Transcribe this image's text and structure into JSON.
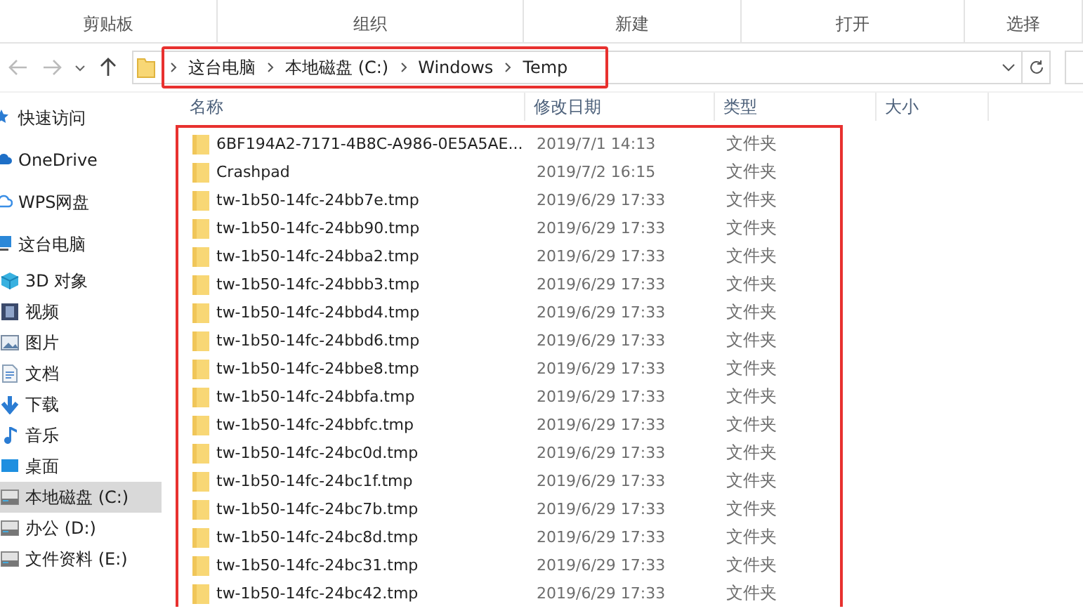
{
  "ribbon_groups": [
    "剪贴板",
    "组织",
    "新建",
    "打开",
    "选择"
  ],
  "address_bar": {
    "highlighted": true,
    "crumbs": [
      "这台电脑",
      "本地磁盘 (C:)",
      "Windows",
      "Temp"
    ]
  },
  "navigation": [
    {
      "label": "快速访问",
      "kind": "star",
      "selected": false
    },
    {
      "label": "OneDrive",
      "kind": "cloud",
      "selected": false
    },
    {
      "label": "WPS网盘",
      "kind": "cloud-outline",
      "selected": false
    },
    {
      "label": "这台电脑",
      "kind": "pc",
      "selected": false,
      "children": [
        {
          "label": "3D 对象",
          "kind": "cube",
          "selected": false
        },
        {
          "label": "视频",
          "kind": "film",
          "selected": false
        },
        {
          "label": "图片",
          "kind": "picture",
          "selected": false
        },
        {
          "label": "文档",
          "kind": "document",
          "selected": false
        },
        {
          "label": "下载",
          "kind": "download",
          "selected": false
        },
        {
          "label": "音乐",
          "kind": "music",
          "selected": false
        },
        {
          "label": "桌面",
          "kind": "desktop",
          "selected": false
        },
        {
          "label": "本地磁盘 (C:)",
          "kind": "drive",
          "selected": true
        },
        {
          "label": "办公 (D:)",
          "kind": "drive",
          "selected": false
        },
        {
          "label": "文件资料 (E:)",
          "kind": "drive",
          "selected": false
        }
      ]
    }
  ],
  "file_list": {
    "highlighted": true,
    "columns": [
      "名称",
      "修改日期",
      "类型",
      "大小"
    ],
    "rows": [
      {
        "name": "6BF194A2-7171-4B8C-A986-0E5A5AE...",
        "modified": "2019/7/1 14:13",
        "type": "文件夹"
      },
      {
        "name": "Crashpad",
        "modified": "2019/7/2 16:15",
        "type": "文件夹"
      },
      {
        "name": "tw-1b50-14fc-24bb7e.tmp",
        "modified": "2019/6/29 17:33",
        "type": "文件夹"
      },
      {
        "name": "tw-1b50-14fc-24bb90.tmp",
        "modified": "2019/6/29 17:33",
        "type": "文件夹"
      },
      {
        "name": "tw-1b50-14fc-24bba2.tmp",
        "modified": "2019/6/29 17:33",
        "type": "文件夹"
      },
      {
        "name": "tw-1b50-14fc-24bbb3.tmp",
        "modified": "2019/6/29 17:33",
        "type": "文件夹"
      },
      {
        "name": "tw-1b50-14fc-24bbd4.tmp",
        "modified": "2019/6/29 17:33",
        "type": "文件夹"
      },
      {
        "name": "tw-1b50-14fc-24bbd6.tmp",
        "modified": "2019/6/29 17:33",
        "type": "文件夹"
      },
      {
        "name": "tw-1b50-14fc-24bbe8.tmp",
        "modified": "2019/6/29 17:33",
        "type": "文件夹"
      },
      {
        "name": "tw-1b50-14fc-24bbfa.tmp",
        "modified": "2019/6/29 17:33",
        "type": "文件夹"
      },
      {
        "name": "tw-1b50-14fc-24bbfc.tmp",
        "modified": "2019/6/29 17:33",
        "type": "文件夹"
      },
      {
        "name": "tw-1b50-14fc-24bc0d.tmp",
        "modified": "2019/6/29 17:33",
        "type": "文件夹"
      },
      {
        "name": "tw-1b50-14fc-24bc1f.tmp",
        "modified": "2019/6/29 17:33",
        "type": "文件夹"
      },
      {
        "name": "tw-1b50-14fc-24bc7b.tmp",
        "modified": "2019/6/29 17:33",
        "type": "文件夹"
      },
      {
        "name": "tw-1b50-14fc-24bc8d.tmp",
        "modified": "2019/6/29 17:33",
        "type": "文件夹"
      },
      {
        "name": "tw-1b50-14fc-24bc31.tmp",
        "modified": "2019/6/29 17:33",
        "type": "文件夹"
      },
      {
        "name": "tw-1b50-14fc-24bc42.tmp",
        "modified": "2019/6/29 17:33",
        "type": "文件夹"
      }
    ]
  }
}
